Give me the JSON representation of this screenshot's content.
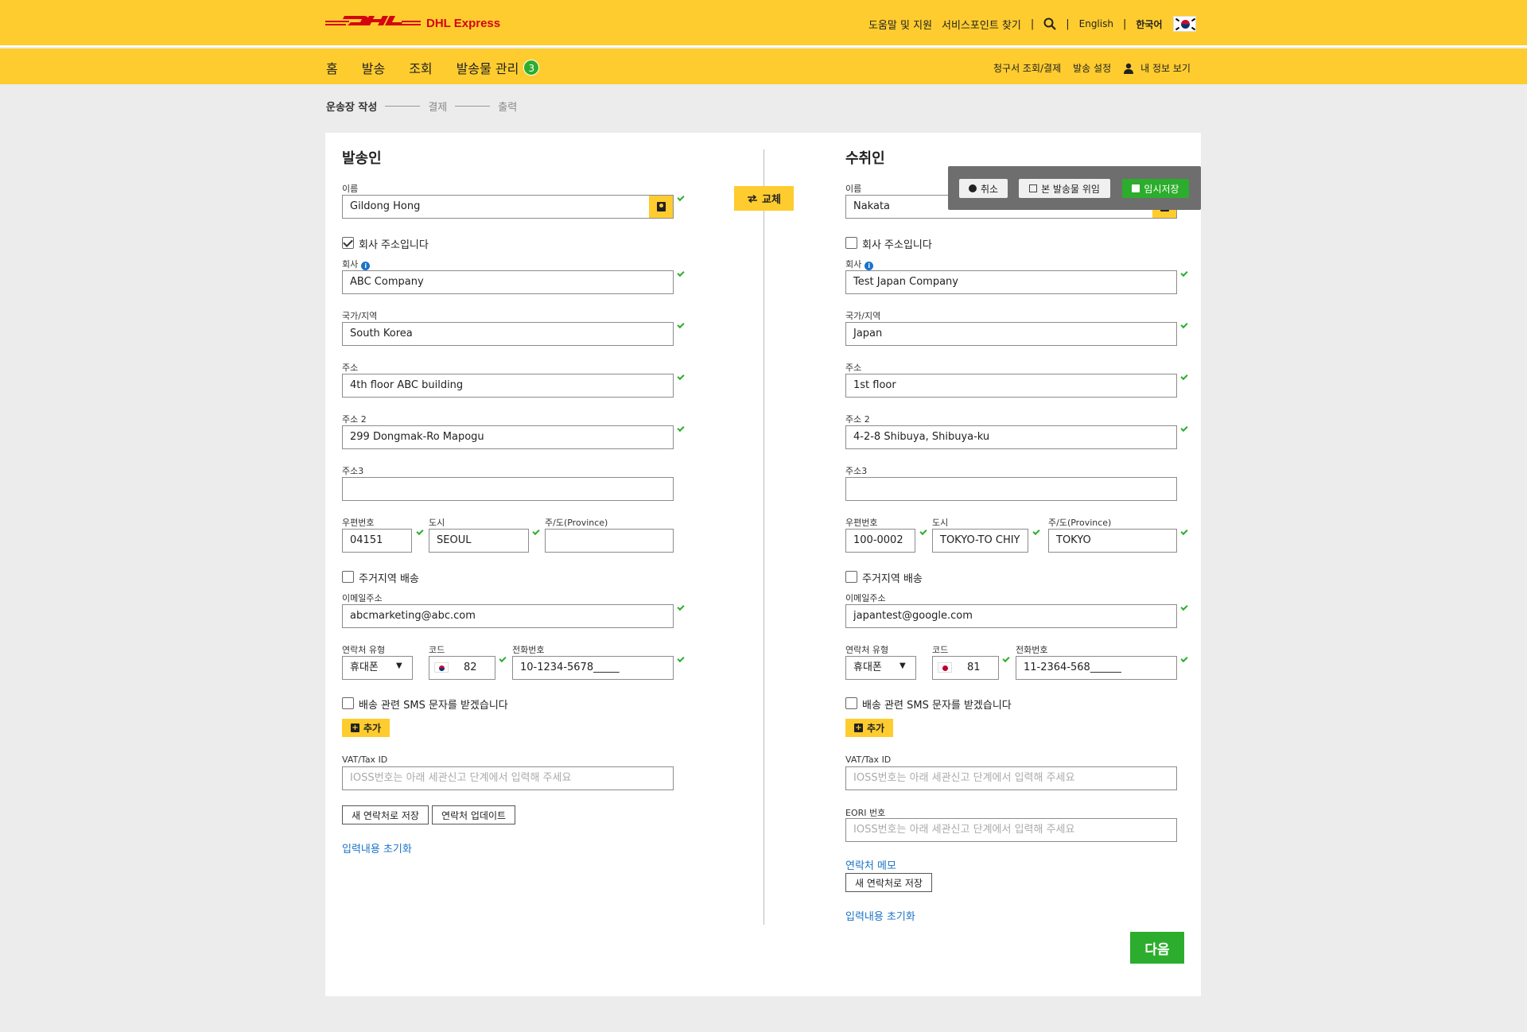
{
  "header": {
    "logo_text": "DHL Express",
    "help_link": "도움말 및 지원",
    "service_point_link": "서비스포인트 찾기",
    "lang_english": "English",
    "lang_korean": "한국어"
  },
  "nav": {
    "home": "홈",
    "ship": "발송",
    "track": "조회",
    "manage": "발송물 관리",
    "manage_badge": "3",
    "billing": "청구서 조회/결제",
    "settings": "발송 설정",
    "profile": "내 정보 보기"
  },
  "steps": {
    "step1": "운송장 작성",
    "step2": "결제",
    "step3": "출력"
  },
  "swap_label": "교체",
  "toolbar": {
    "cancel": "취소",
    "delegate": "본 발송물 위임",
    "save_draft": "임시저장"
  },
  "sender": {
    "title": "발송인",
    "name_label": "이름",
    "name": "Gildong Hong",
    "is_company_label": "회사 주소입니다",
    "company_label": "회사",
    "company": "ABC Company",
    "country_label": "국가/지역",
    "country": "South Korea",
    "address_label": "주소",
    "address": "4th floor ABC building",
    "address2_label": "주소 2",
    "address2": "299 Dongmak-Ro Mapogu",
    "address3_label": "주소3",
    "address3": "",
    "postal_label": "우편번호",
    "postal": "04151",
    "city_label": "도시",
    "city": "SEOUL",
    "province_label": "주/도(Province)",
    "province": "",
    "residential_label": "주거지역 배송",
    "email_label": "이메일주소",
    "email": "abcmarketing@abc.com",
    "contact_type_label": "연락처 유형",
    "contact_type": "휴대폰",
    "code_label": "코드",
    "code": "82",
    "phone_label": "전화번호",
    "phone": "10-1234-5678_____",
    "sms_label": "배송 관련 SMS 문자를 받겠습니다",
    "add_label": "추가",
    "vat_label": "VAT/Tax ID",
    "vat_placeholder": "IOSS번호는 아래 세관신고 단계에서 입력해 주세요",
    "save_contact": "새 연락처로 저장",
    "update_contact": "연락처 업데이트",
    "reset": "입력내용 초기화"
  },
  "receiver": {
    "title": "수취인",
    "name_label": "이름",
    "name": "Nakata",
    "is_company_label": "회사 주소입니다",
    "company_label": "회사",
    "company": "Test Japan Company",
    "country_label": "국가/지역",
    "country": "Japan",
    "address_label": "주소",
    "address": "1st floor",
    "address2_label": "주소 2",
    "address2": "4-2-8 Shibuya, Shibuya-ku",
    "address3_label": "주소3",
    "address3": "",
    "postal_label": "우편번호",
    "postal": "100-0002",
    "city_label": "도시",
    "city": "TOKYO-TO CHIY",
    "province_label": "주/도(Province)",
    "province": "TOKYO",
    "residential_label": "주거지역 배송",
    "email_label": "이메일주소",
    "email": "japantest@google.com",
    "contact_type_label": "연락처 유형",
    "contact_type": "휴대폰",
    "code_label": "코드",
    "code": "81",
    "phone_label": "전화번호",
    "phone": "11-2364-568______",
    "sms_label": "배송 관련 SMS 문자를 받겠습니다",
    "add_label": "추가",
    "vat_label": "VAT/Tax ID",
    "vat_placeholder": "IOSS번호는 아래 세관신고 단계에서 입력해 주세요",
    "eori_label": "EORI 번호",
    "eori_placeholder": "IOSS번호는 아래 세관신고 단계에서 입력해 주세요",
    "memo_link": "연락처 메모",
    "save_contact": "새 연락처로 저장",
    "reset": "입력내용 초기화"
  },
  "next_label": "다음",
  "colors": {
    "brand_yellow": "#fecc2f",
    "brand_red": "#d40511",
    "success_green": "#2dad2d",
    "link_blue": "#1a73c8"
  }
}
